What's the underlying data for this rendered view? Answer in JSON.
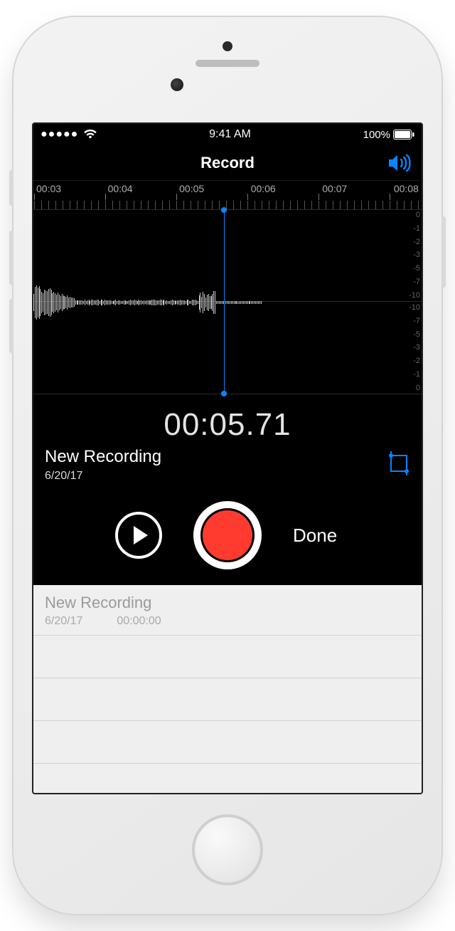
{
  "status": {
    "time": "9:41 AM",
    "battery": "100%"
  },
  "nav": {
    "title": "Record"
  },
  "timeline": {
    "labels": [
      "00:03",
      "00:04",
      "00:05",
      "00:06",
      "00:07",
      "00:08"
    ]
  },
  "db_scale": [
    "0",
    "-1",
    "-2",
    "-3",
    "-5",
    "-7",
    "-10"
  ],
  "recorder": {
    "elapsed": "00:05.71",
    "title": "New Recording",
    "date": "6/20/17",
    "done_label": "Done"
  },
  "list": {
    "items": [
      {
        "title": "New Recording",
        "date": "6/20/17",
        "duration": "00:00:00"
      }
    ]
  },
  "colors": {
    "accent": "#0a84ff",
    "record": "#ff3b30"
  }
}
